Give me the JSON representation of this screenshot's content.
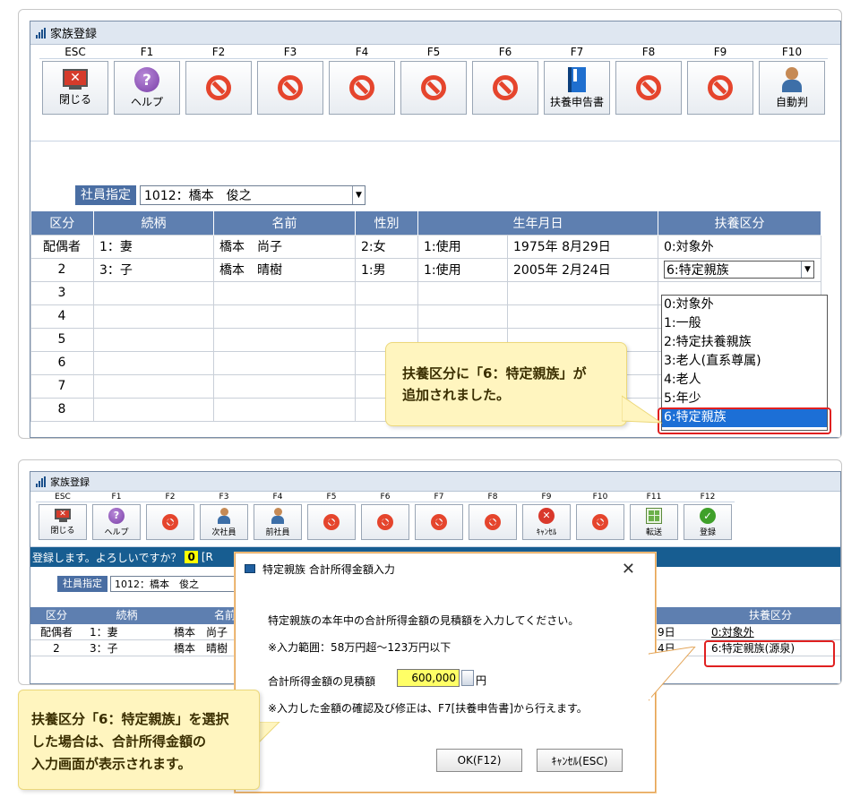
{
  "panel1": {
    "window_title": "家族登録",
    "toolbar": [
      {
        "key": "ESC",
        "label": "閉じる",
        "icon": "close-monitor-icon"
      },
      {
        "key": "F1",
        "label": "ヘルプ",
        "icon": "help-icon"
      },
      {
        "key": "F2",
        "label": "",
        "icon": "disabled-icon"
      },
      {
        "key": "F3",
        "label": "",
        "icon": "disabled-icon"
      },
      {
        "key": "F4",
        "label": "",
        "icon": "disabled-icon"
      },
      {
        "key": "F5",
        "label": "",
        "icon": "disabled-icon"
      },
      {
        "key": "F6",
        "label": "",
        "icon": "disabled-icon"
      },
      {
        "key": "F7",
        "label": "扶養申告書",
        "icon": "book-icon"
      },
      {
        "key": "F8",
        "label": "",
        "icon": "disabled-icon"
      },
      {
        "key": "F9",
        "label": "",
        "icon": "disabled-icon"
      },
      {
        "key": "F10",
        "label": "自動判",
        "icon": "people-icon"
      }
    ],
    "employee_label": "社員指定",
    "employee_value": "1012：橋本　俊之",
    "headers": [
      "区分",
      "続柄",
      "名前",
      "性別",
      "生年月日",
      "扶養区分"
    ],
    "rows": [
      {
        "kubun": "配偶者",
        "rel": "1：妻",
        "name": "橋本　尚子",
        "sex": "2:女",
        "era": "1:使用",
        "birth": "1975年 8月29日",
        "fuyou": "0:対象外"
      },
      {
        "kubun": "2",
        "rel": "3：子",
        "name": "橋本　晴樹",
        "sex": "1:男",
        "era": "1:使用",
        "birth": "2005年 2月24日",
        "fuyou": "6:特定親族"
      },
      {
        "kubun": "3",
        "rel": "",
        "name": "",
        "sex": "",
        "era": "",
        "birth": "",
        "fuyou": ""
      },
      {
        "kubun": "4",
        "rel": "",
        "name": "",
        "sex": "",
        "era": "",
        "birth": "",
        "fuyou": ""
      },
      {
        "kubun": "5",
        "rel": "",
        "name": "",
        "sex": "",
        "era": "",
        "birth": "",
        "fuyou": ""
      },
      {
        "kubun": "6",
        "rel": "",
        "name": "",
        "sex": "",
        "era": "",
        "birth": "",
        "fuyou": ""
      },
      {
        "kubun": "7",
        "rel": "",
        "name": "",
        "sex": "",
        "era": "",
        "birth": "",
        "fuyou": ""
      },
      {
        "kubun": "8",
        "rel": "",
        "name": "",
        "sex": "",
        "era": "",
        "birth": "",
        "fuyou": ""
      }
    ],
    "dropdown_options": [
      "0:対象外",
      "1:一般",
      "2:特定扶養親族",
      "3:老人(直系尊属)",
      "4:老人",
      "5:年少",
      "6:特定親族"
    ],
    "dropdown_selected": "6:特定親族",
    "callout_line1": "扶養区分に「6：特定親族」が",
    "callout_line2": "追加されました。"
  },
  "panel2": {
    "window_title": "家族登録",
    "toolbar": [
      {
        "key": "ESC",
        "label": "閉じる",
        "icon": "close-monitor-icon"
      },
      {
        "key": "F1",
        "label": "ヘルプ",
        "icon": "help-icon"
      },
      {
        "key": "F2",
        "label": "",
        "icon": "disabled-icon"
      },
      {
        "key": "F3",
        "label": "次社員",
        "icon": "next-employee-icon"
      },
      {
        "key": "F4",
        "label": "前社員",
        "icon": "prev-employee-icon"
      },
      {
        "key": "F5",
        "label": "",
        "icon": "disabled-icon"
      },
      {
        "key": "F6",
        "label": "",
        "icon": "disabled-icon"
      },
      {
        "key": "F7",
        "label": "",
        "icon": "disabled-icon"
      },
      {
        "key": "F8",
        "label": "",
        "icon": "disabled-icon"
      },
      {
        "key": "F9",
        "label": "ｷｬﾝｾﾙ",
        "icon": "cancel-icon"
      },
      {
        "key": "F10",
        "label": "",
        "icon": "disabled-icon"
      },
      {
        "key": "F11",
        "label": "転送",
        "icon": "transfer-icon"
      },
      {
        "key": "F12",
        "label": "登録",
        "icon": "check-icon"
      }
    ],
    "status_text": "登録します。よろしいですか？",
    "status_value": "0",
    "status_suffix": "[R",
    "employee_label": "社員指定",
    "employee_value": "1012：橋本　俊之",
    "headers": [
      "区分",
      "続柄",
      "名前",
      "扶養区分"
    ],
    "rows": [
      {
        "kubun": "配偶者",
        "rel": "1：妻",
        "name": "橋本　尚子",
        "date": "9日",
        "fuyou": "0:対象外"
      },
      {
        "kubun": "2",
        "rel": "3：子",
        "name": "橋本　晴樹",
        "date": "4日",
        "fuyou": "6:特定親族(源泉)"
      }
    ],
    "dialog": {
      "title": "特定親族 合計所得金額入力",
      "instruction": "特定親族の本年中の合計所得金額の見積額を入力してください。",
      "range": "※入力範囲：58万円超～123万円以下",
      "field_label": "合計所得金額の見積額",
      "field_value": "600,000",
      "unit": "円",
      "note": "※入力した金額の確認及び修正は、F7[扶養申告書]から行えます。",
      "ok_label": "OK(F12)",
      "cancel_label": "ｷｬﾝｾﾙ(ESC)"
    },
    "callout_line1": "扶養区分「6：特定親族」を選択",
    "callout_line2": "した場合は、合計所得金額の",
    "callout_line3": "入力画面が表示されます。"
  }
}
